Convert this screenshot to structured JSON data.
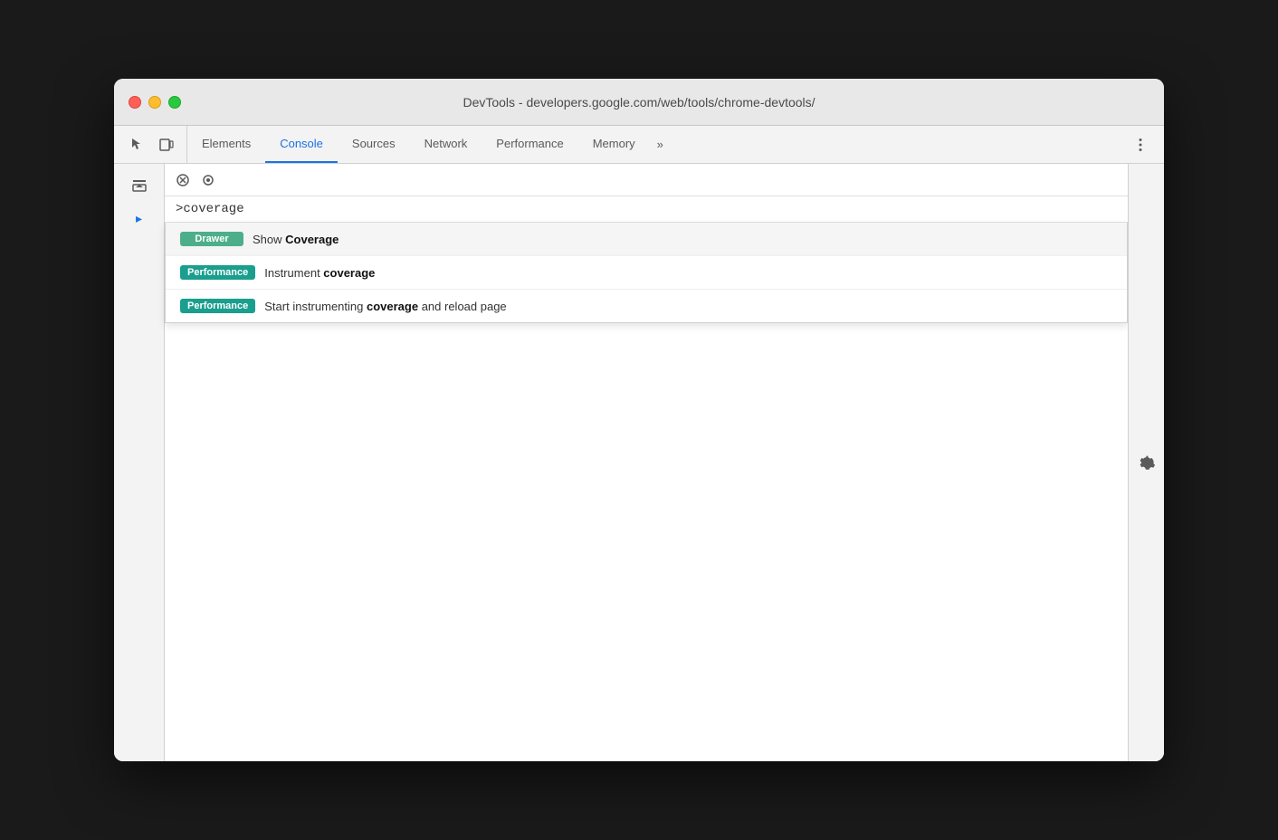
{
  "window": {
    "title": "DevTools - developers.google.com/web/tools/chrome-devtools/"
  },
  "tabs": {
    "items": [
      {
        "id": "elements",
        "label": "Elements",
        "active": false
      },
      {
        "id": "console",
        "label": "Console",
        "active": true
      },
      {
        "id": "sources",
        "label": "Sources",
        "active": false
      },
      {
        "id": "network",
        "label": "Network",
        "active": false
      },
      {
        "id": "performance",
        "label": "Performance",
        "active": false
      },
      {
        "id": "memory",
        "label": "Memory",
        "active": false
      }
    ],
    "overflow_label": "»"
  },
  "search": {
    "value": ">coverage"
  },
  "autocomplete": {
    "items": [
      {
        "badge_label": "Drawer",
        "badge_class": "badge-drawer",
        "text_before": "Show ",
        "text_highlight": "Coverage",
        "text_after": ""
      },
      {
        "badge_label": "Performance",
        "badge_class": "badge-performance",
        "text_before": "Instrument ",
        "text_highlight": "coverage",
        "text_after": ""
      },
      {
        "badge_label": "Performance",
        "badge_class": "badge-performance",
        "text_before": "Start instrumenting ",
        "text_highlight": "coverage",
        "text_after": " and reload page"
      }
    ]
  }
}
